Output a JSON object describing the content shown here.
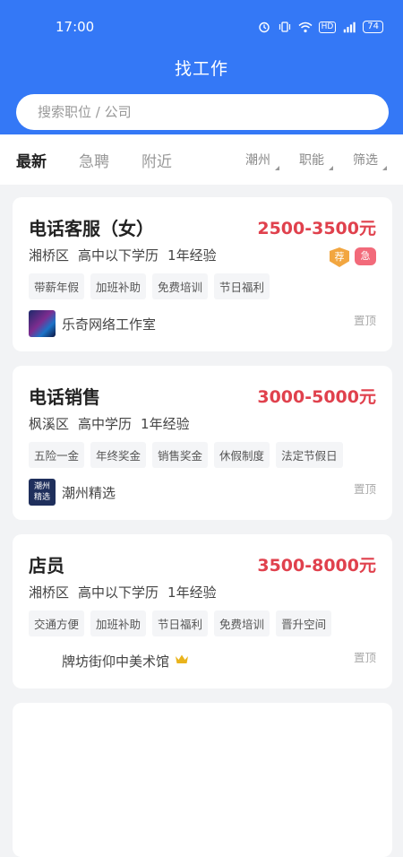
{
  "status_bar": {
    "time": "17:00",
    "hd": "HD",
    "signal": "4G",
    "battery": "74"
  },
  "header": {
    "title": "找工作"
  },
  "search": {
    "placeholder": "搜索职位 / 公司"
  },
  "tabs": [
    {
      "label": "最新",
      "active": true
    },
    {
      "label": "急聘",
      "active": false
    },
    {
      "label": "附近",
      "active": false
    }
  ],
  "filters": [
    "潮州",
    "职能",
    "筛选"
  ],
  "jobs": [
    {
      "title": "电话客服（女）",
      "salary": "2500-3500元",
      "district": "湘桥区",
      "education": "高中以下学历",
      "experience": "1年经验",
      "tags": [
        "带薪年假",
        "加班补助",
        "免费培训",
        "节日福利"
      ],
      "company": "乐奇网络工作室",
      "pin": "置顶",
      "badge_recommend": "荐",
      "badge_urgent": "急"
    },
    {
      "title": "电话销售",
      "salary": "3000-5000元",
      "district": "枫溪区",
      "education": "高中学历",
      "experience": "1年经验",
      "tags": [
        "五险一金",
        "年终奖金",
        "销售奖金",
        "休假制度",
        "法定节假日"
      ],
      "company": "潮州精选",
      "logo_text_line1": "潮州",
      "logo_text_line2": "精选",
      "pin": "置顶"
    },
    {
      "title": "店员",
      "salary": "3500-8000元",
      "district": "湘桥区",
      "education": "高中以下学历",
      "experience": "1年经验",
      "tags": [
        "交通方便",
        "加班补助",
        "节日福利",
        "免费培训",
        "晋升空间"
      ],
      "company": "牌坊街仰中美术馆",
      "pin": "置顶"
    }
  ],
  "icons": {
    "alarm": "alarm-icon",
    "vibrate": "vibrate-icon",
    "wifi": "wifi-icon",
    "signal": "signal-icon",
    "crown": "crown-icon",
    "dropdown": "dropdown-triangle-icon"
  },
  "colors": {
    "brand": "#3478f6",
    "salary": "#e0414d",
    "background": "#f2f3f5"
  }
}
